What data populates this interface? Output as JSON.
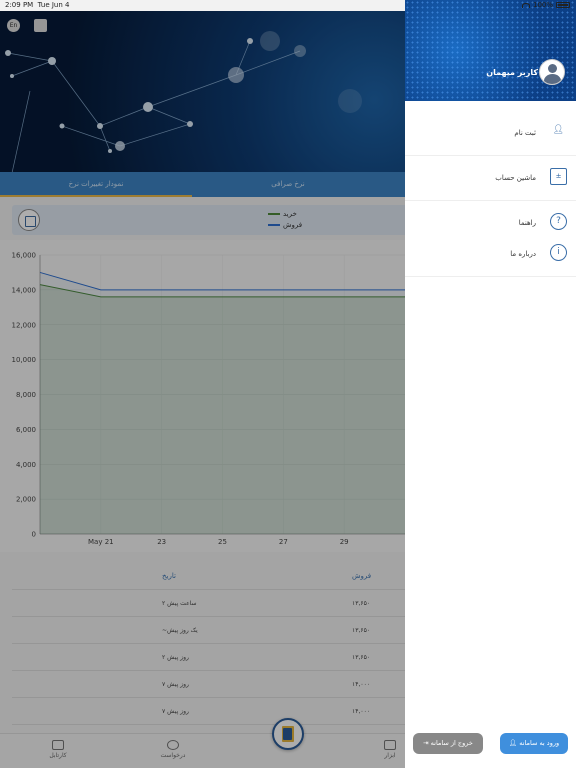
{
  "status": {
    "time": "2:09 PM",
    "date": "Tue Jun 4",
    "battery": "100%"
  },
  "header": {
    "lang_button": "En",
    "calc_icon": "calculator-icon"
  },
  "tabs": [
    {
      "label": "نمودار تغییرات نرخ",
      "active": true
    },
    {
      "label": "نرخ صرافی",
      "active": false
    },
    {
      "label": "",
      "active": false
    }
  ],
  "legend": {
    "buy": "خرید",
    "sell": "فروش",
    "buy_color": "#4f8a3a",
    "sell_color": "#2f6fd0"
  },
  "chart_data": {
    "type": "line",
    "y_ticks": [
      "0",
      "2,000",
      "4,000",
      "6,000",
      "8,000",
      "10,000",
      "12,000",
      "14,000",
      "16,000"
    ],
    "ylim": [
      0,
      16000
    ],
    "x_ticks": [
      "May 21",
      "23",
      "25",
      "27",
      "29"
    ],
    "x": [
      19,
      21,
      23,
      25,
      27,
      29,
      31
    ],
    "series": [
      {
        "name": "خرید",
        "color": "#4f8a3a",
        "values": [
          14300,
          13600,
          13600,
          13600,
          13600,
          13600,
          13600
        ]
      },
      {
        "name": "فروش",
        "color": "#2f6fd0",
        "values": [
          15000,
          14000,
          14000,
          14000,
          14000,
          14000,
          14000
        ]
      }
    ],
    "grid": true
  },
  "table": {
    "headers": {
      "sell": "فروش",
      "date": "تاریخ"
    },
    "rows": [
      {
        "sell": "۱۳,۶۵۰",
        "date": "۲ ساعت پیش"
      },
      {
        "sell": "۱۳,۶۵۰",
        "date": "~یک روز پیش"
      },
      {
        "sell": "۱۳,۶۵۰",
        "date": "۲ روز پیش"
      },
      {
        "sell": "۱۴,۰۰۰",
        "date": "۷ روز پیش"
      },
      {
        "sell": "۱۴,۰۰۰",
        "date": "۷ روز پیش"
      }
    ]
  },
  "bottom_nav": {
    "items": [
      "کارتابل",
      "درخواست",
      "ابزار"
    ]
  },
  "drawer": {
    "user_title": "کاربر میهمان",
    "menu": [
      {
        "label": "ثبت نام",
        "icon": "add-user-icon"
      },
      {
        "label": "ماشین حساب",
        "icon": "calculator-icon"
      },
      {
        "label": "راهنما",
        "icon": "help-icon"
      },
      {
        "label": "درباره ما",
        "icon": "info-icon"
      }
    ],
    "login_button": "ورود به سامانه",
    "exit_button": "خروج از سامانه"
  }
}
